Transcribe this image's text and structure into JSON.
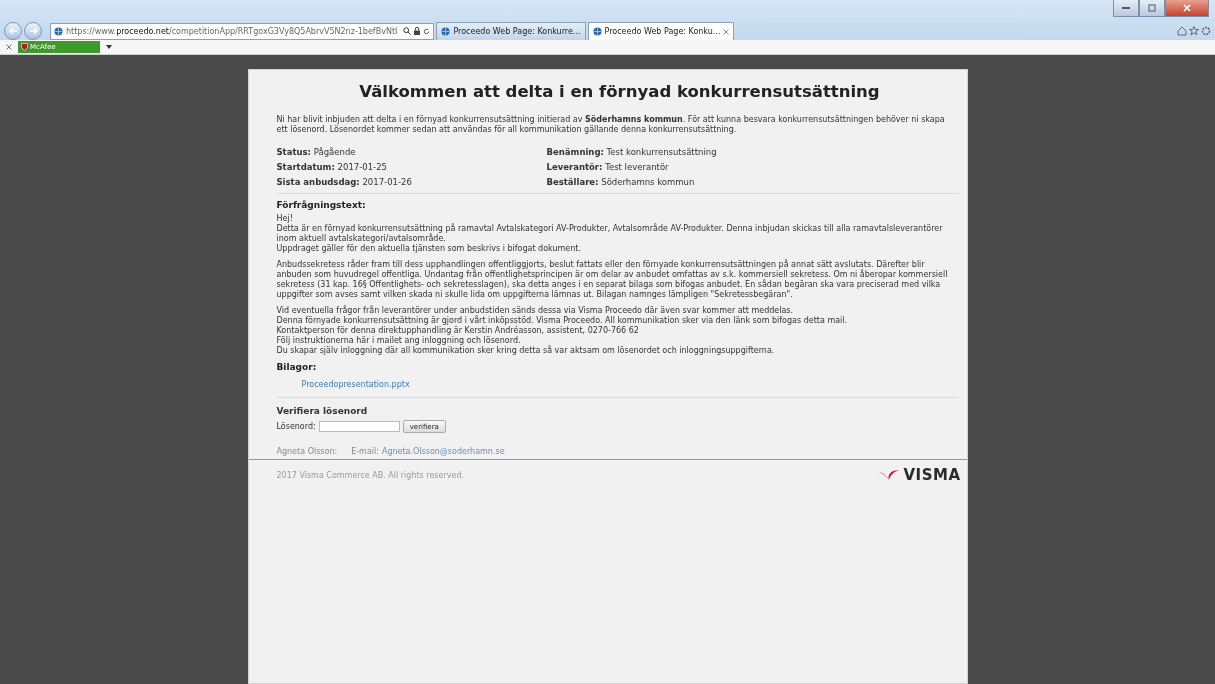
{
  "browser": {
    "url_parts": [
      {
        "text": "https://www.",
        "kind": "muted"
      },
      {
        "text": "proceedo.net",
        "kind": "host"
      },
      {
        "text": "/competitionApp/RRTgoxG3Vy8Q5AbrvV5N2nz-1befBvNtI",
        "kind": "muted"
      }
    ],
    "tabs": [
      {
        "title": "Proceedo Web Page: Konkurre...",
        "selected": false
      },
      {
        "title": "Proceedo Web Page: Konku...",
        "selected": true
      }
    ],
    "toolbar": {
      "addon": "McAfee"
    }
  },
  "page": {
    "title": "Välkommen att delta i en förnyad konkurrensutsättning",
    "intro": "Ni har blivit inbjuden att delta i en förnyad konkurrensutsättning initierad av **Söderhamns kommun**. För att kunna besvara konkurrensutsättningen behöver ni skapa ett lösenord. Lösenordet kommer sedan att användas för all kommunikation gällande denna konkurrensutsättning.",
    "details": [
      {
        "label": "Status:",
        "value": "Pågående"
      },
      {
        "label": "Benämning:",
        "value": "Test konkurrensutsättning"
      },
      {
        "label": "Startdatum:",
        "value": "2017-01-25"
      },
      {
        "label": "Leverantör:",
        "value": "Test leverantör"
      },
      {
        "label": "Sista anbudsdag:",
        "value": "2017-01-26"
      },
      {
        "label": "Beställare:",
        "value": "Söderhamns kommun"
      }
    ],
    "inquiry_heading": "Förfrågningstext:",
    "inquiry_paragraphs": [
      [
        "Hej!",
        "Detta är en förnyad konkurrensutsättning på ramavtal Avtalskategori AV-Produkter, Avtalsområde AV-Produkter. Denna inbjudan skickas till alla ramavtalsleverantörer inom aktuell avtalskategori/avtalsområde.",
        "Uppdraget gäller för den aktuella tjänsten som beskrivs i bifogat dokument."
      ],
      [
        "Anbudssekretess råder fram till dess upphandlingen offentliggjorts, beslut fattats eller den förnyade konkurrensutsättningen på annat sätt avslutats. Därefter blir anbuden som huvudregel offentliga. Undantag från offentlighetsprincipen är om delar av anbudet omfattas av s.k. kommersiell sekretess. Om ni åberopar kommersiell sekretess (31 kap. 16§ Offentlighets- och sekretesslagen), ska detta anges i en separat bilaga som bifogas anbudet. En sådan begäran ska vara preciserad med vilka uppgifter som avses samt vilken skada ni skulle lida om uppgifterna lämnas ut. Bilagan namnges lämpligen \"Sekretessbegäran\"."
      ],
      [
        "Vid eventuella frågor från leverantörer under anbudstiden sänds dessa via Visma Proceedo där även svar kommer att meddelas.",
        "Denna förnyade konkurrensutsättning är gjord i vårt inköpsstöd. Visma Proceedo. All kommunikation sker via den länk som bifogas detta mail.",
        "Kontaktperson för denna direktupphandling är Kerstin Andréasson, assistent, 0270-766 62",
        "Följ instruktionerna här i mailet ang inloggning och lösenord.",
        "Du skapar själv inloggning där all kommunikation sker kring detta så var aktsam om lösenordet och inloggningsuppgifterna."
      ]
    ],
    "attachments_heading": "Bilagor:",
    "attachments": [
      "Proceedopresentation.pptx"
    ],
    "verify": {
      "heading": "Verifiera lösenord",
      "label": "Lösenord:",
      "button": "verifiera"
    },
    "contact": {
      "name": "Agneta Olsson:",
      "email_label": "E-mail:",
      "email": "Agneta.Olsson@soderhamn.se"
    },
    "copyright": "2017 Visma Commerce AB. All rights reserved.",
    "logo": "VISMA"
  }
}
